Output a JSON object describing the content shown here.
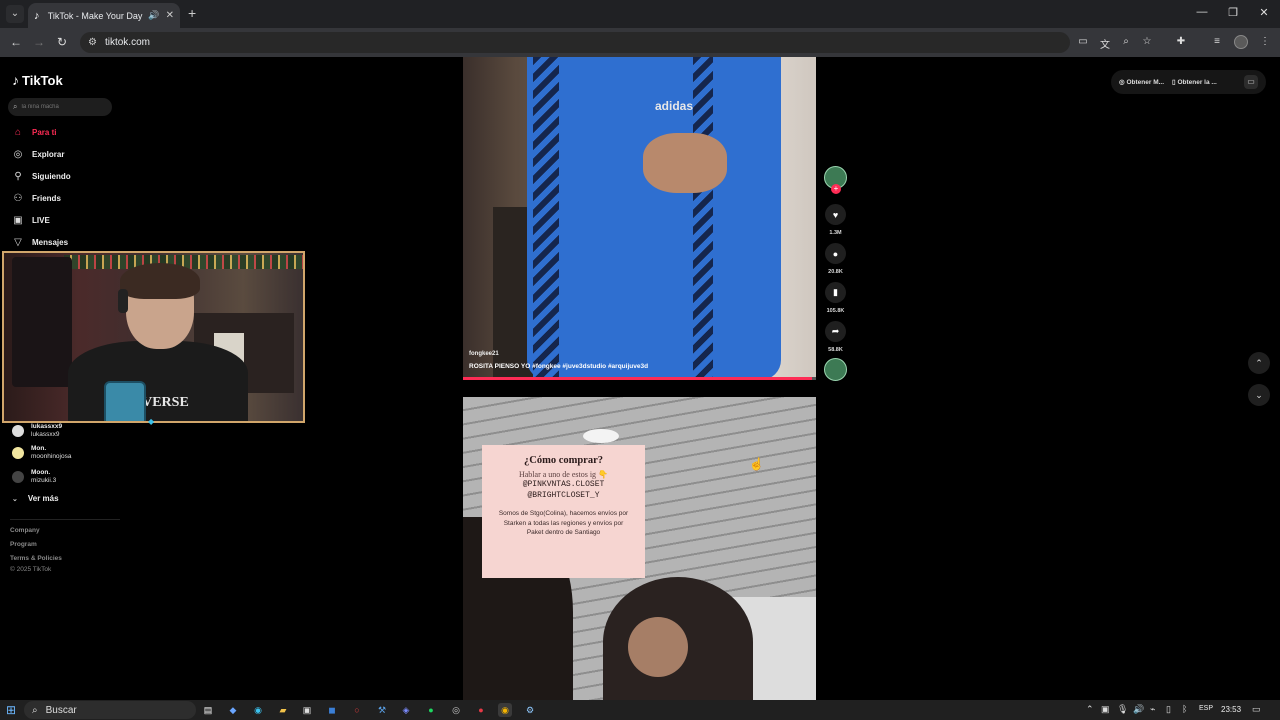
{
  "browser": {
    "tab_title": "TikTok - Make Your Day",
    "url": "tiktok.com",
    "icons": [
      "tab-list-icon",
      "speaker-icon",
      "close-icon",
      "new-tab-icon",
      "back-icon",
      "forward-icon",
      "reload-icon",
      "site-settings-icon",
      "cast-icon",
      "translate-icon",
      "zoom-icon",
      "bookmark-star-icon",
      "extensions-icon",
      "media-icon",
      "profile-icon",
      "menu-icon"
    ]
  },
  "tiktok": {
    "logo": "TikTok",
    "search_placeholder": "la niña macha",
    "nav": [
      {
        "label": "Para ti",
        "icon": "home-icon"
      },
      {
        "label": "Explorar",
        "icon": "compass-icon"
      },
      {
        "label": "Siguiendo",
        "icon": "following-icon"
      },
      {
        "label": "Friends",
        "icon": "friends-icon"
      },
      {
        "label": "LIVE",
        "icon": "live-icon"
      },
      {
        "label": "Mensajes",
        "icon": "messages-icon"
      }
    ],
    "following": [
      {
        "line1": "lukassxx9",
        "line2": "lukassxx9"
      },
      {
        "line1": "Mon.",
        "line2": "moonhinojosa"
      },
      {
        "line1": "Moon.",
        "line2": "mizukii.3"
      }
    ],
    "ver_mas": "Ver más",
    "footer": [
      "Company",
      "Program",
      "Terms & Policies",
      "© 2025 TikTok"
    ],
    "video1": {
      "brand": "adidas",
      "username": "fongkee21",
      "caption": "ROSITA PIENSO YO #fongkee #juve3dstudio #arquijuve3d",
      "progress": 0.99,
      "likes": "1.3M",
      "comments": "20.8K",
      "saves": "105.8K",
      "shares": "58.8K"
    },
    "video2": {
      "card_title": "¿Cómo comprar?",
      "card_sub": "Hablar a uno de estos ig 👇",
      "card_ig1": "@PINKVNTAS.CLOSET",
      "card_ig2": "@BRIGHTCLOSET_Y",
      "card_body": "Somos de Stgo(Colina), hacemos envíos por Starken a todas las regiones y envíos por Paket dentro de Santiago"
    },
    "pills": [
      "Obtener M...",
      "Obtener la ..."
    ]
  },
  "webcam": {
    "shirt_text": "NVERSE"
  },
  "taskbar": {
    "search_label": "Buscar",
    "lang": "ESP",
    "time": "23:53"
  }
}
